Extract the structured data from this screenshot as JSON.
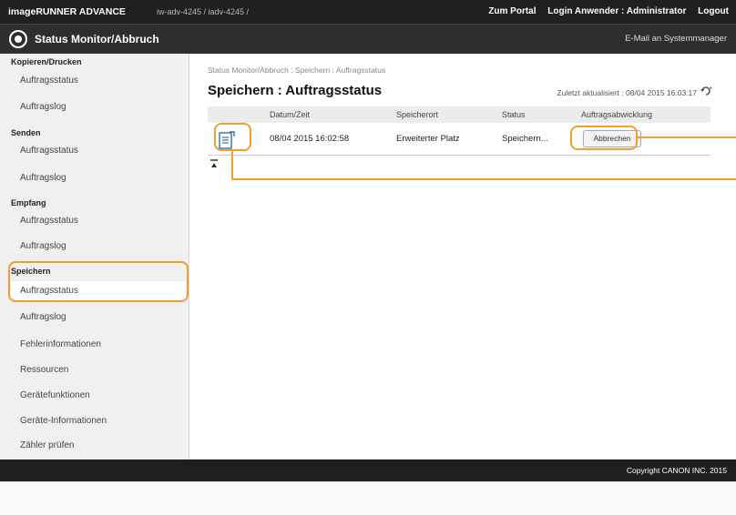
{
  "header": {
    "product": "imageRUNNER ADVANCE",
    "hostname": "iw-adv-4245 / iadv-4245 /",
    "portal_link": "Zum Portal",
    "login_label": "Login Anwender : Administrator",
    "logout_label": "Logout"
  },
  "titlebar": {
    "title": "Status Monitor/Abbruch",
    "email_link": "E-Mail an Systemmanager"
  },
  "sidebar": {
    "sections": [
      {
        "header": "Kopieren/Drucken",
        "items": [
          "Auftragsstatus",
          "Auftragslog"
        ]
      },
      {
        "header": "Senden",
        "items": [
          "Auftragsstatus",
          "Auftragslog"
        ]
      },
      {
        "header": "Empfang",
        "items": [
          "Auftragsstatus",
          "Auftragslog"
        ]
      },
      {
        "header": "Speichern",
        "items": [
          "Auftragsstatus",
          "Auftragslog"
        ]
      }
    ],
    "extra_items": [
      "Fehlerinformationen",
      "Ressourcen",
      "Gerätefunktionen",
      "Geräte-Informationen",
      "Zähler prüfen"
    ]
  },
  "main": {
    "breadcrumb": "Status Monitor/Abbruch : Speichern : Auftragsstatus",
    "title": "Speichern : Auftragsstatus",
    "updated": "Zuletzt aktualisiert : 08/04 2015 16:03:17",
    "table": {
      "headers": [
        "Datum/Zeit",
        "Speicherort",
        "Status",
        "Auftragsabwicklung"
      ],
      "rows": [
        {
          "datetime": "08/04 2015 16:02:58",
          "location": "Erweiterter Platz",
          "status": "Speichern...",
          "action": "Abbrechen"
        }
      ]
    }
  },
  "footer": {
    "copyright": "Copyright CANON INC. 2015"
  },
  "colors": {
    "highlight": "#f0a030",
    "topbar": "#1f1f1f",
    "sidebar": "#f0f0f0"
  }
}
